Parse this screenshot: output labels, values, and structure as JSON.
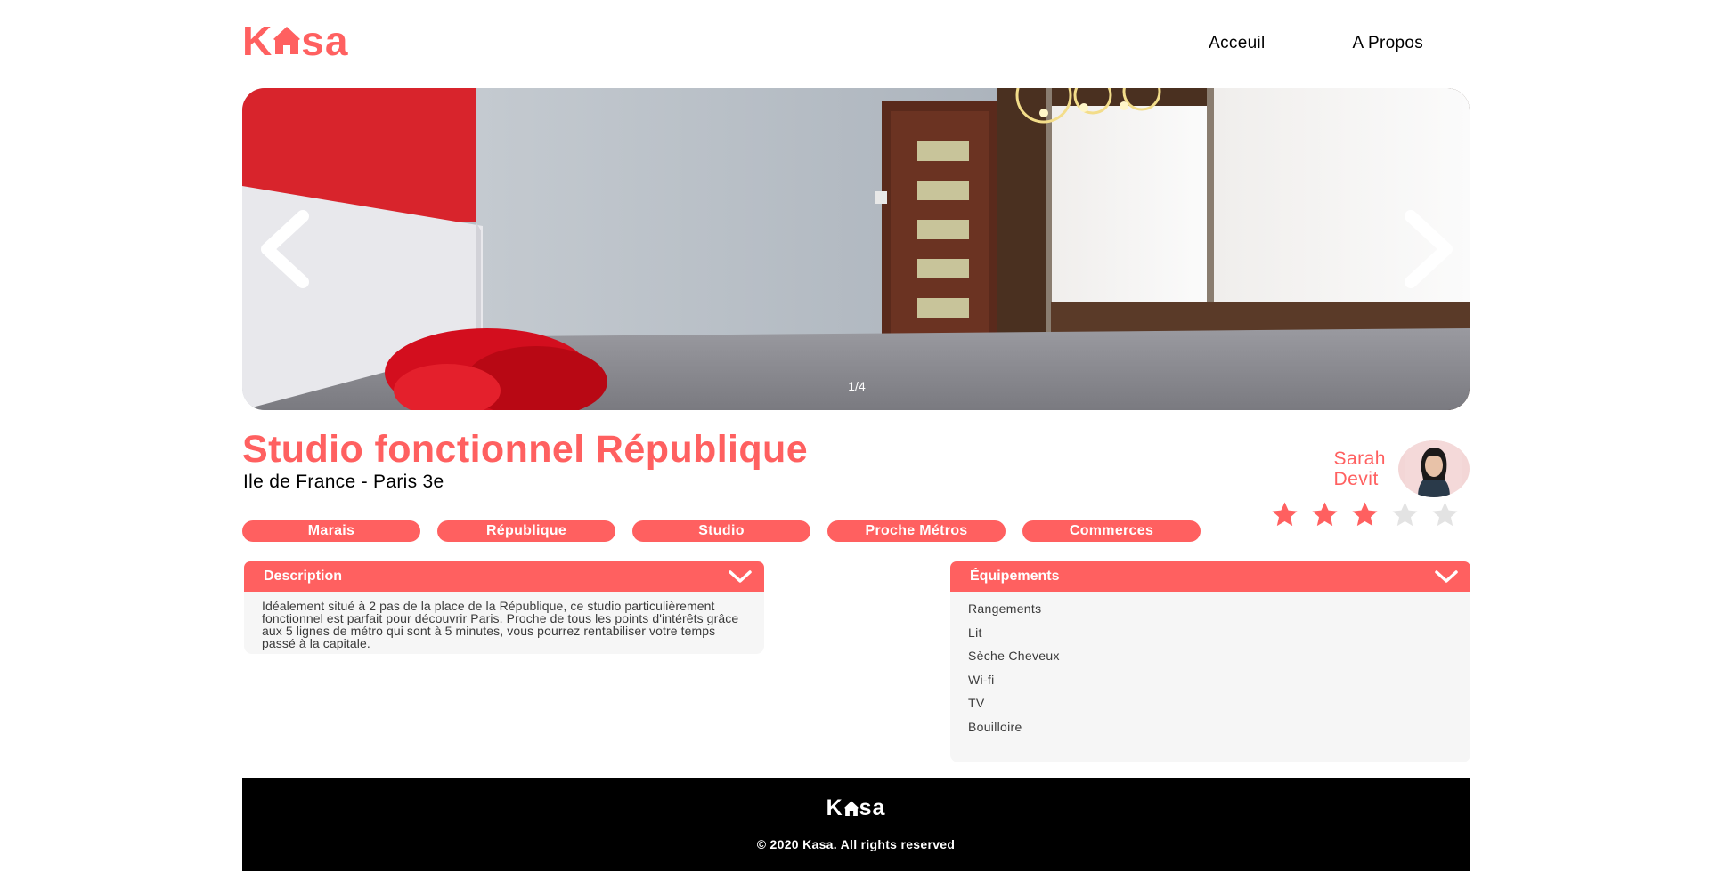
{
  "header": {
    "logo_letters": {
      "first": "K",
      "rest": "sa"
    },
    "nav": [
      {
        "label": "Acceuil"
      },
      {
        "label": "A Propos"
      }
    ]
  },
  "carousel": {
    "counter": "1/4",
    "current": 1,
    "total": 4
  },
  "listing": {
    "title": "Studio fonctionnel République",
    "location": "Ile de France - Paris 3e",
    "tags": [
      "Marais",
      "République",
      "Studio",
      "Proche Métros",
      "Commerces"
    ],
    "host": {
      "first_name": "Sarah",
      "last_name": "Devit"
    },
    "rating": 3,
    "rating_max": 5
  },
  "description": {
    "title": "Description",
    "text": "Idéalement situé à 2 pas de la place de la République, ce studio particulièrement fonctionnel est parfait pour découvrir Paris. Proche de tous les points d'intérêts grâce aux 5 lignes de métro qui sont à 5 minutes, vous pourrez rentabiliser votre temps passé à la capitale."
  },
  "equipments": {
    "title": "Équipements",
    "items": [
      "Rangements",
      "Lit",
      "Sèche Cheveux",
      "Wi-fi",
      "TV",
      "Bouilloire"
    ]
  },
  "footer": {
    "logo_letters": {
      "first": "K",
      "rest": "sa"
    },
    "copyright": "© 2020 Kasa. All rights reserved"
  },
  "colors": {
    "brand": "#FF6060",
    "background": "#FFFFFF",
    "panel": "#F6F6F6",
    "footer": "#000000",
    "star_empty": "#E3E3E3"
  }
}
